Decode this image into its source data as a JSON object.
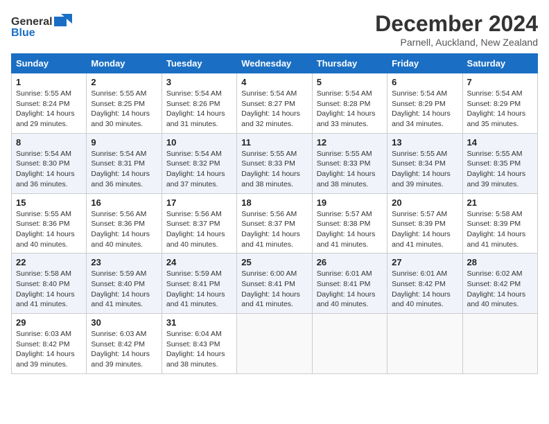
{
  "logo": {
    "general": "General",
    "blue": "Blue"
  },
  "title": "December 2024",
  "location": "Parnell, Auckland, New Zealand",
  "days_of_week": [
    "Sunday",
    "Monday",
    "Tuesday",
    "Wednesday",
    "Thursday",
    "Friday",
    "Saturday"
  ],
  "weeks": [
    [
      {
        "day": "1",
        "info": "Sunrise: 5:55 AM\nSunset: 8:24 PM\nDaylight: 14 hours\nand 29 minutes."
      },
      {
        "day": "2",
        "info": "Sunrise: 5:55 AM\nSunset: 8:25 PM\nDaylight: 14 hours\nand 30 minutes."
      },
      {
        "day": "3",
        "info": "Sunrise: 5:54 AM\nSunset: 8:26 PM\nDaylight: 14 hours\nand 31 minutes."
      },
      {
        "day": "4",
        "info": "Sunrise: 5:54 AM\nSunset: 8:27 PM\nDaylight: 14 hours\nand 32 minutes."
      },
      {
        "day": "5",
        "info": "Sunrise: 5:54 AM\nSunset: 8:28 PM\nDaylight: 14 hours\nand 33 minutes."
      },
      {
        "day": "6",
        "info": "Sunrise: 5:54 AM\nSunset: 8:29 PM\nDaylight: 14 hours\nand 34 minutes."
      },
      {
        "day": "7",
        "info": "Sunrise: 5:54 AM\nSunset: 8:29 PM\nDaylight: 14 hours\nand 35 minutes."
      }
    ],
    [
      {
        "day": "8",
        "info": "Sunrise: 5:54 AM\nSunset: 8:30 PM\nDaylight: 14 hours\nand 36 minutes."
      },
      {
        "day": "9",
        "info": "Sunrise: 5:54 AM\nSunset: 8:31 PM\nDaylight: 14 hours\nand 36 minutes."
      },
      {
        "day": "10",
        "info": "Sunrise: 5:54 AM\nSunset: 8:32 PM\nDaylight: 14 hours\nand 37 minutes."
      },
      {
        "day": "11",
        "info": "Sunrise: 5:55 AM\nSunset: 8:33 PM\nDaylight: 14 hours\nand 38 minutes."
      },
      {
        "day": "12",
        "info": "Sunrise: 5:55 AM\nSunset: 8:33 PM\nDaylight: 14 hours\nand 38 minutes."
      },
      {
        "day": "13",
        "info": "Sunrise: 5:55 AM\nSunset: 8:34 PM\nDaylight: 14 hours\nand 39 minutes."
      },
      {
        "day": "14",
        "info": "Sunrise: 5:55 AM\nSunset: 8:35 PM\nDaylight: 14 hours\nand 39 minutes."
      }
    ],
    [
      {
        "day": "15",
        "info": "Sunrise: 5:55 AM\nSunset: 8:36 PM\nDaylight: 14 hours\nand 40 minutes."
      },
      {
        "day": "16",
        "info": "Sunrise: 5:56 AM\nSunset: 8:36 PM\nDaylight: 14 hours\nand 40 minutes."
      },
      {
        "day": "17",
        "info": "Sunrise: 5:56 AM\nSunset: 8:37 PM\nDaylight: 14 hours\nand 40 minutes."
      },
      {
        "day": "18",
        "info": "Sunrise: 5:56 AM\nSunset: 8:37 PM\nDaylight: 14 hours\nand 41 minutes."
      },
      {
        "day": "19",
        "info": "Sunrise: 5:57 AM\nSunset: 8:38 PM\nDaylight: 14 hours\nand 41 minutes."
      },
      {
        "day": "20",
        "info": "Sunrise: 5:57 AM\nSunset: 8:39 PM\nDaylight: 14 hours\nand 41 minutes."
      },
      {
        "day": "21",
        "info": "Sunrise: 5:58 AM\nSunset: 8:39 PM\nDaylight: 14 hours\nand 41 minutes."
      }
    ],
    [
      {
        "day": "22",
        "info": "Sunrise: 5:58 AM\nSunset: 8:40 PM\nDaylight: 14 hours\nand 41 minutes."
      },
      {
        "day": "23",
        "info": "Sunrise: 5:59 AM\nSunset: 8:40 PM\nDaylight: 14 hours\nand 41 minutes."
      },
      {
        "day": "24",
        "info": "Sunrise: 5:59 AM\nSunset: 8:41 PM\nDaylight: 14 hours\nand 41 minutes."
      },
      {
        "day": "25",
        "info": "Sunrise: 6:00 AM\nSunset: 8:41 PM\nDaylight: 14 hours\nand 41 minutes."
      },
      {
        "day": "26",
        "info": "Sunrise: 6:01 AM\nSunset: 8:41 PM\nDaylight: 14 hours\nand 40 minutes."
      },
      {
        "day": "27",
        "info": "Sunrise: 6:01 AM\nSunset: 8:42 PM\nDaylight: 14 hours\nand 40 minutes."
      },
      {
        "day": "28",
        "info": "Sunrise: 6:02 AM\nSunset: 8:42 PM\nDaylight: 14 hours\nand 40 minutes."
      }
    ],
    [
      {
        "day": "29",
        "info": "Sunrise: 6:03 AM\nSunset: 8:42 PM\nDaylight: 14 hours\nand 39 minutes."
      },
      {
        "day": "30",
        "info": "Sunrise: 6:03 AM\nSunset: 8:42 PM\nDaylight: 14 hours\nand 39 minutes."
      },
      {
        "day": "31",
        "info": "Sunrise: 6:04 AM\nSunset: 8:43 PM\nDaylight: 14 hours\nand 38 minutes."
      },
      {
        "day": "",
        "info": ""
      },
      {
        "day": "",
        "info": ""
      },
      {
        "day": "",
        "info": ""
      },
      {
        "day": "",
        "info": ""
      }
    ]
  ]
}
